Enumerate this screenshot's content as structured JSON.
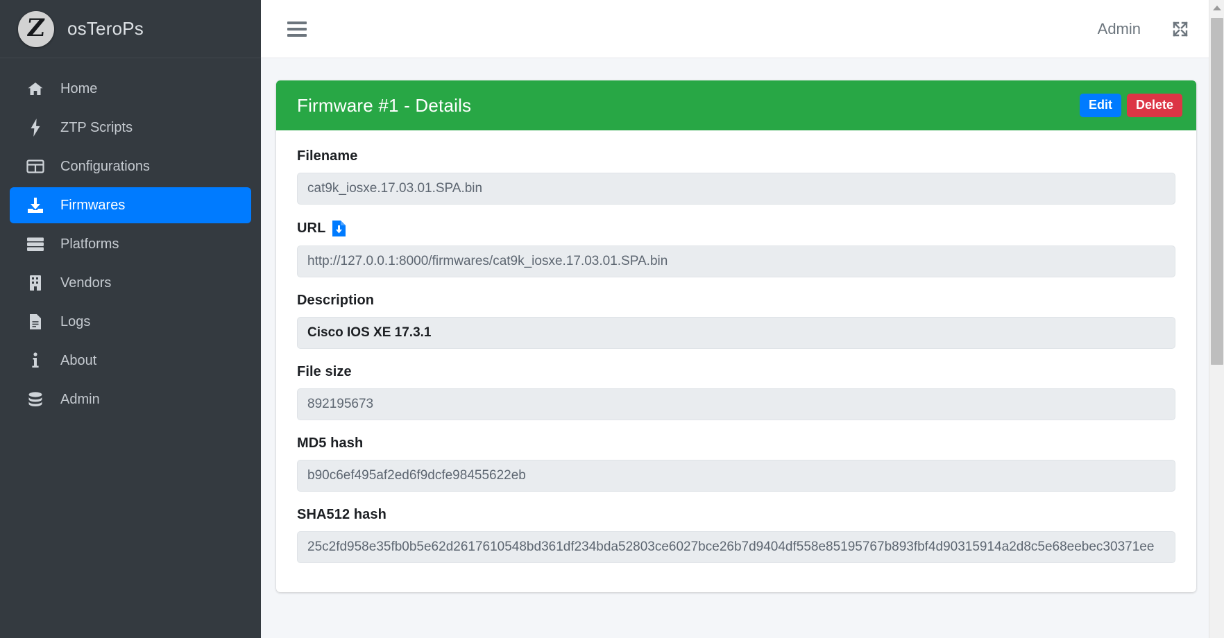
{
  "brand": {
    "logo_letter": "Z",
    "logo_icon": "circle-z-logo",
    "name": "osTeroPs"
  },
  "sidebar": {
    "items": [
      {
        "label": "Home",
        "icon": "home-icon",
        "active": false
      },
      {
        "label": "ZTP Scripts",
        "icon": "bolt-icon",
        "active": false
      },
      {
        "label": "Configurations",
        "icon": "table-icon",
        "active": false
      },
      {
        "label": "Firmwares",
        "icon": "download-box-icon",
        "active": true
      },
      {
        "label": "Platforms",
        "icon": "server-rack-icon",
        "active": false
      },
      {
        "label": "Vendors",
        "icon": "building-icon",
        "active": false
      },
      {
        "label": "Logs",
        "icon": "file-lines-icon",
        "active": false
      },
      {
        "label": "About",
        "icon": "info-icon",
        "active": false
      },
      {
        "label": "Admin",
        "icon": "database-icon",
        "active": false
      }
    ]
  },
  "topbar": {
    "menu_icon": "hamburger-icon",
    "user_label": "Admin",
    "fullscreen_icon": "expand-arrows-icon"
  },
  "card": {
    "title": "Firmware #1 - Details",
    "header_color": "#28a745",
    "edit_label": "Edit",
    "edit_color": "#007bff",
    "delete_label": "Delete",
    "delete_color": "#dc3545"
  },
  "fields": {
    "filename": {
      "label": "Filename",
      "value": "cat9k_iosxe.17.03.01.SPA.bin"
    },
    "url": {
      "label": "URL",
      "download_icon": "file-download-icon",
      "value": "http://127.0.0.1:8000/firmwares/cat9k_iosxe.17.03.01.SPA.bin"
    },
    "description": {
      "label": "Description",
      "value": "Cisco IOS XE 17.3.1"
    },
    "filesize": {
      "label": "File size",
      "value": "892195673"
    },
    "md5": {
      "label": "MD5 hash",
      "value": "b90c6ef495af2ed6f9dcfe98455622eb"
    },
    "sha512": {
      "label": "SHA512 hash",
      "value": "25c2fd958e35fb0b5e62d2617610548bd361df234bda52803ce6027bce26b7d9404df558e85195767b893fbf4d90315914a2d8c5e68eebec30371ee"
    }
  },
  "scrollbar": {
    "up_arrow_icon": "scroll-up-arrow-icon"
  }
}
